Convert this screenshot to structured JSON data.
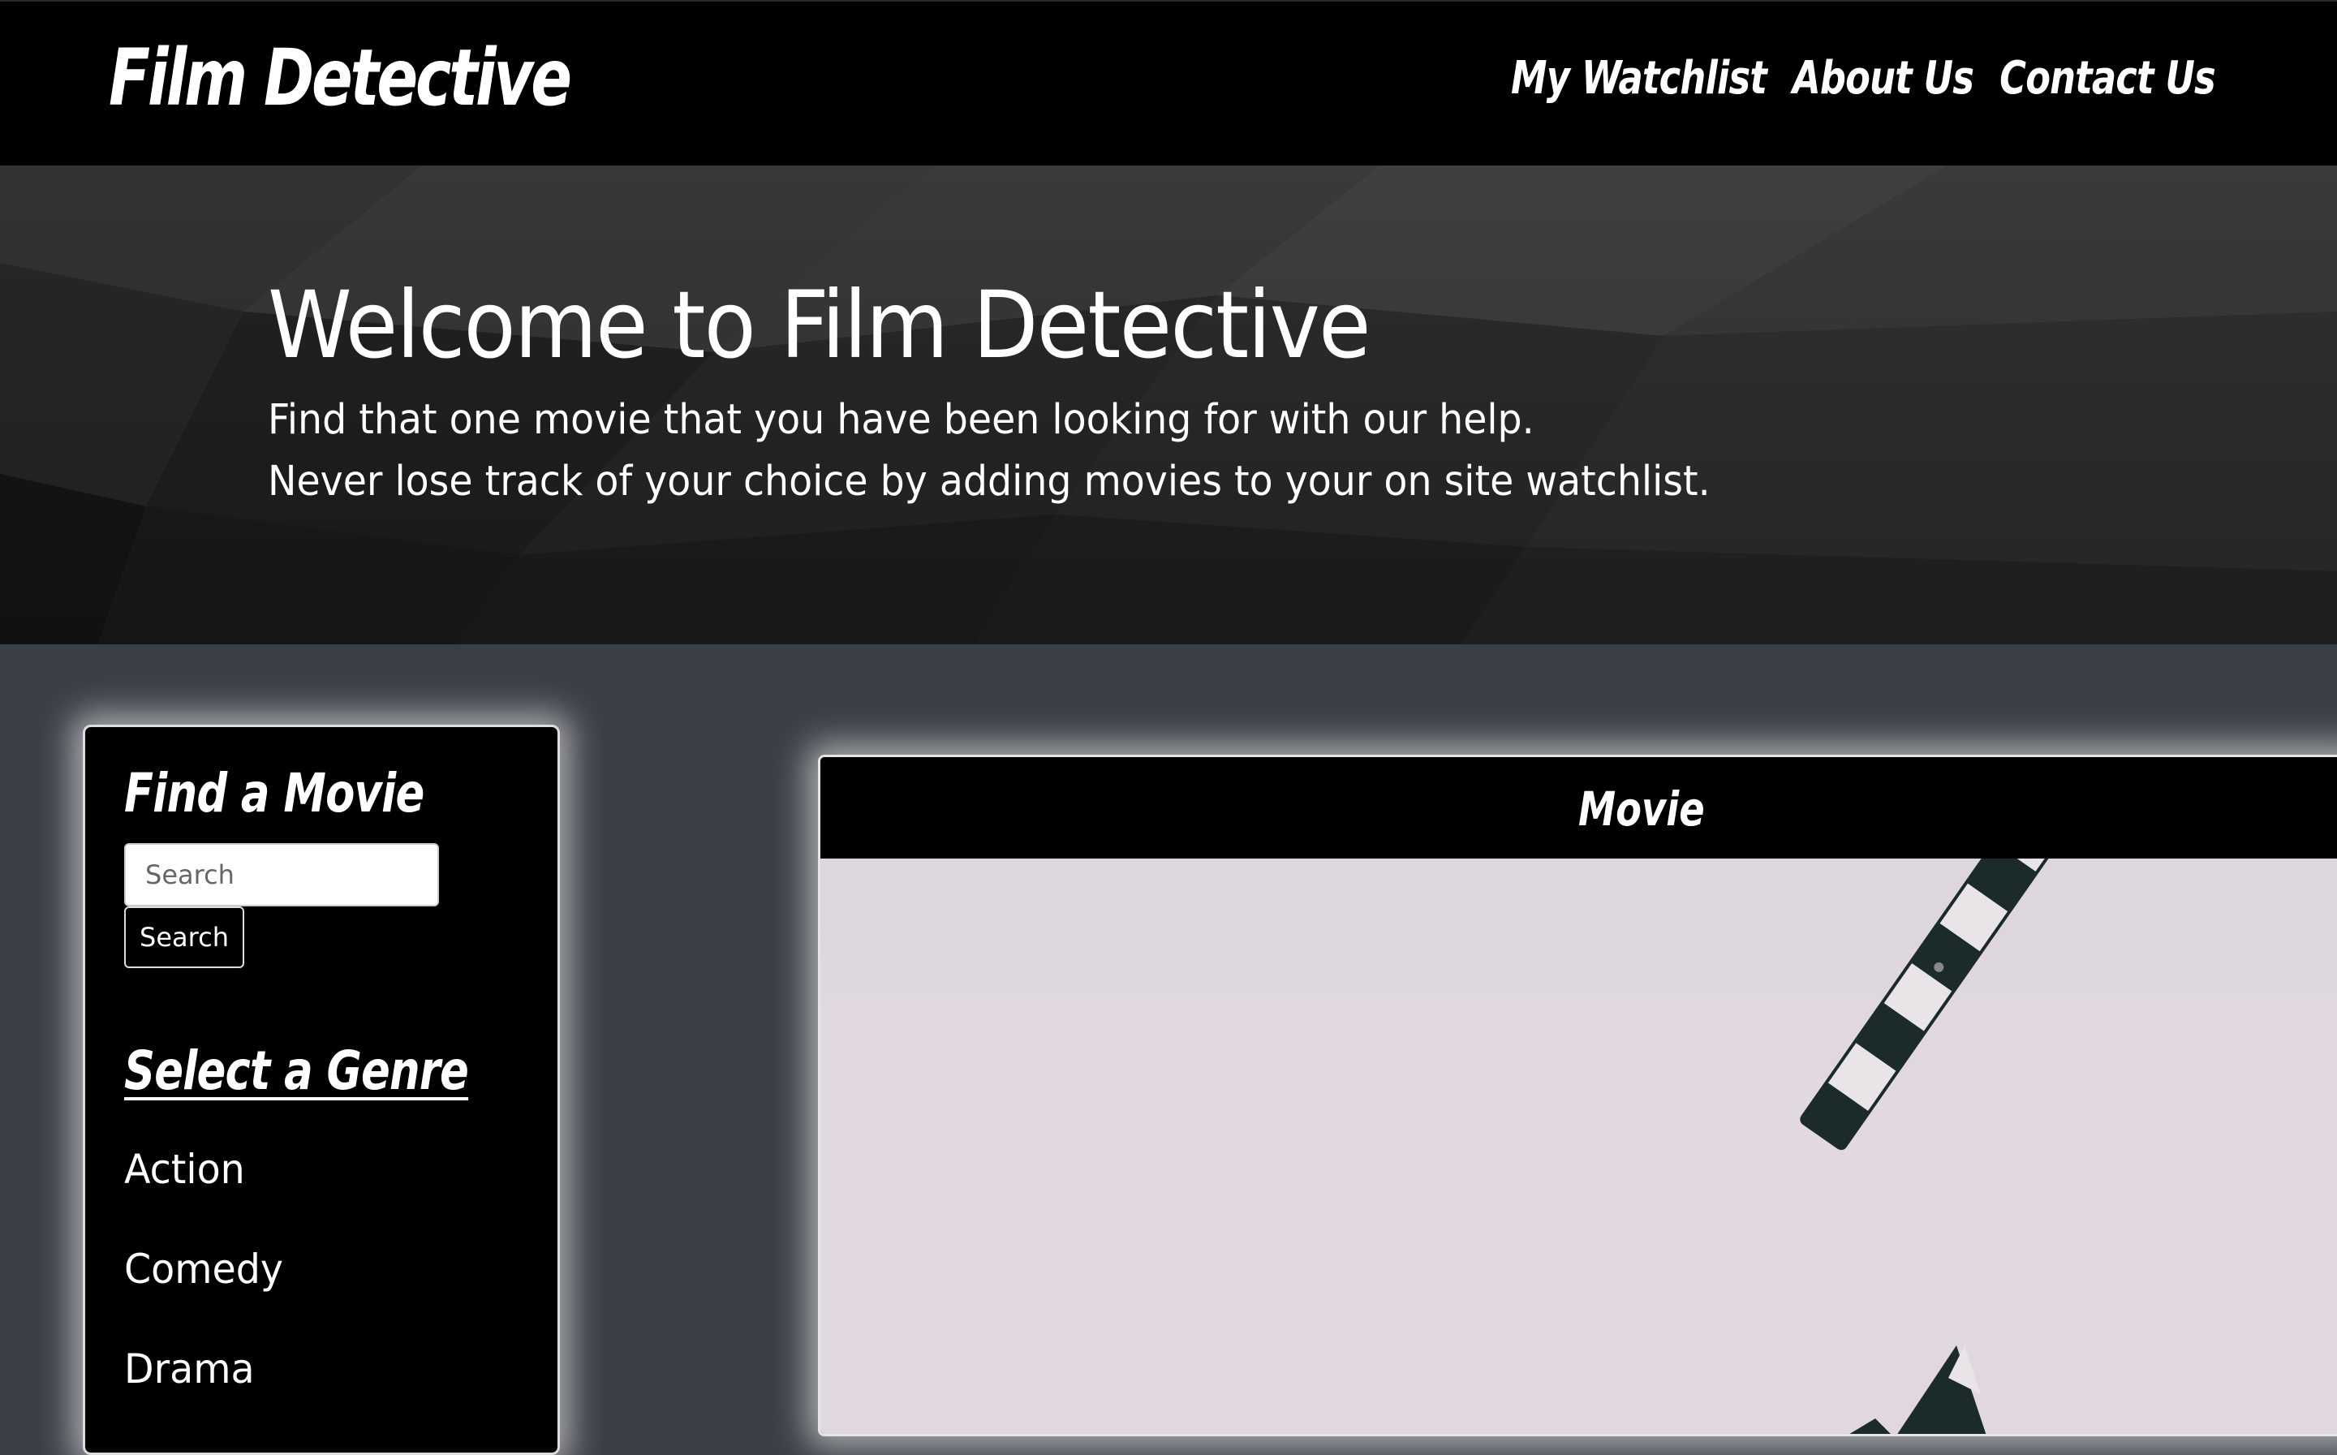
{
  "navbar": {
    "brand": "Film Detective",
    "links": [
      "My Watchlist",
      "About Us",
      "Contact Us"
    ]
  },
  "hero": {
    "title": "Welcome to Film Detective",
    "line1": "Find that one movie that you have been looking for with our help.",
    "line2": "Never lose track of your choice by adding movies to your on site watchlist."
  },
  "sidebar": {
    "find_heading": "Find a Movie",
    "search_placeholder": "Search",
    "search_button": "Search",
    "genre_heading": "Select a Genre",
    "genres": [
      "Action",
      "Comedy",
      "Drama"
    ]
  },
  "movie": {
    "title": "Movie"
  },
  "colors": {
    "navbar_bg": "#000000",
    "page_bg": "#3b4047",
    "card_bg": "#000000",
    "card_border": "#e5e5e5",
    "image_bg": "#e0d7df"
  },
  "icons": {
    "movie_image": "clapperboard-image"
  }
}
